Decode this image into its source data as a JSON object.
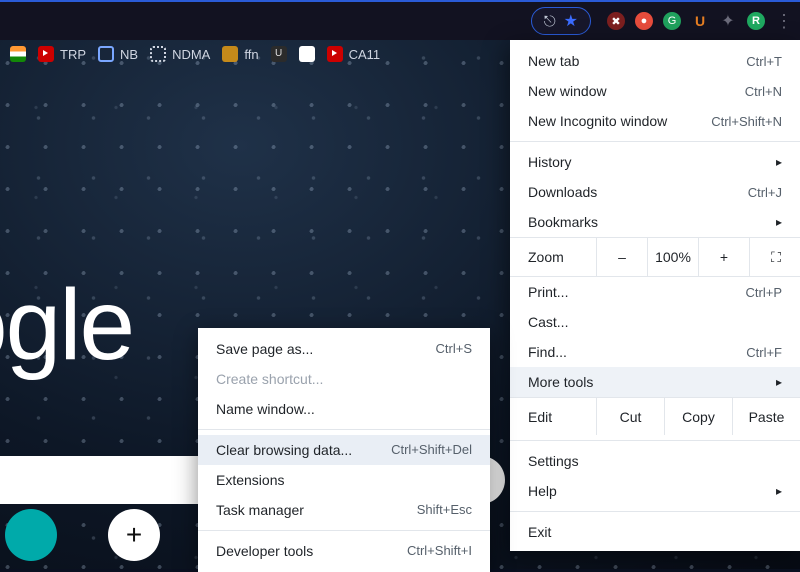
{
  "toolbar": {
    "icons": {
      "share": "share-icon",
      "star": "star-icon",
      "ext1": "red-badge-icon",
      "ext2": "recorder-icon",
      "ext3": "grammarly-icon",
      "ext4": "u-icon",
      "ext5": "puzzle-icon",
      "avatar": "R",
      "overflow": "⋮"
    }
  },
  "bookmarks": [
    {
      "label": "",
      "fav": "in"
    },
    {
      "label": "TRP",
      "fav": "yt"
    },
    {
      "label": "NB",
      "fav": "nb"
    },
    {
      "label": "NDMA",
      "fav": "nd"
    },
    {
      "label": "ffn",
      "fav": "ff"
    },
    {
      "label": "",
      "fav": "u"
    },
    {
      "label": "",
      "fav": "x"
    },
    {
      "label": "CA11",
      "fav": "yt"
    }
  ],
  "page": {
    "logo_partial": "ogle",
    "shortcut_add": "+"
  },
  "submenu": {
    "items": [
      {
        "label": "Save page as...",
        "shortcut": "Ctrl+S",
        "state": ""
      },
      {
        "label": "Create shortcut...",
        "shortcut": "",
        "state": "dis"
      },
      {
        "label": "Name window...",
        "shortcut": "",
        "state": ""
      },
      {
        "sep": true
      },
      {
        "label": "Clear browsing data...",
        "shortcut": "Ctrl+Shift+Del",
        "state": "hl"
      },
      {
        "label": "Extensions",
        "shortcut": "",
        "state": ""
      },
      {
        "label": "Task manager",
        "shortcut": "Shift+Esc",
        "state": ""
      },
      {
        "sep": true
      },
      {
        "label": "Developer tools",
        "shortcut": "Ctrl+Shift+I",
        "state": ""
      }
    ]
  },
  "menu": {
    "block1": [
      {
        "label": "New tab",
        "shortcut": "Ctrl+T"
      },
      {
        "label": "New window",
        "shortcut": "Ctrl+N"
      },
      {
        "label": "New Incognito window",
        "shortcut": "Ctrl+Shift+N"
      }
    ],
    "block2": [
      {
        "label": "History",
        "shortcut": "",
        "sub": true
      },
      {
        "label": "Downloads",
        "shortcut": "Ctrl+J",
        "sub": false
      },
      {
        "label": "Bookmarks",
        "shortcut": "",
        "sub": true
      }
    ],
    "zoom": {
      "label": "Zoom",
      "minus": "–",
      "value": "100%",
      "plus": "+",
      "full": "⛶"
    },
    "block3": [
      {
        "label": "Print...",
        "shortcut": "Ctrl+P"
      },
      {
        "label": "Cast...",
        "shortcut": ""
      },
      {
        "label": "Find...",
        "shortcut": "Ctrl+F"
      },
      {
        "label": "More tools",
        "shortcut": "",
        "sub": true,
        "hl": true
      }
    ],
    "edit": {
      "label": "Edit",
      "cut": "Cut",
      "copy": "Copy",
      "paste": "Paste"
    },
    "block4": [
      {
        "label": "Settings",
        "shortcut": ""
      },
      {
        "label": "Help",
        "shortcut": "",
        "sub": true
      }
    ],
    "block5": [
      {
        "label": "Exit",
        "shortcut": ""
      }
    ]
  }
}
